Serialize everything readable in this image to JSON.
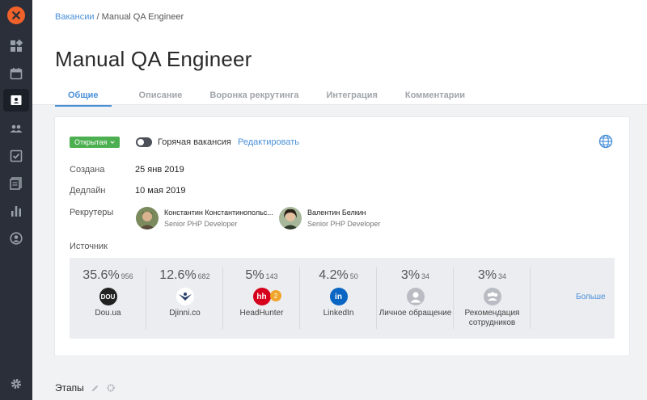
{
  "breadcrumb": {
    "parent": "Вакансии",
    "separator": " / ",
    "current": "Manual QA Engineer"
  },
  "page": {
    "title": "Manual QA Engineer"
  },
  "tabs": [
    {
      "label": "Общие",
      "active": true
    },
    {
      "label": "Описание"
    },
    {
      "label": "Воронка рекрутинга"
    },
    {
      "label": "Интеграция"
    },
    {
      "label": "Комментарии"
    }
  ],
  "vacancy": {
    "status": "Открытая",
    "hot_label": "Горячая вакансия",
    "edit_label": "Редактировать",
    "created_label": "Создана",
    "created_value": "25 янв 2019",
    "deadline_label": "Дедлайн",
    "deadline_value": "10 мая 2019",
    "recruiters_label": "Рекрутеры",
    "source_label": "Источник"
  },
  "recruiters": [
    {
      "name": "Константин Константинопольс...",
      "role": "Senior PHP Developer"
    },
    {
      "name": "Валентин Белкин",
      "role": "Senior PHP Developer"
    }
  ],
  "sources": [
    {
      "percent": "35.6%",
      "count": "956",
      "name": "Dou.ua",
      "icon": "dou-logo-icon",
      "color": "#222222"
    },
    {
      "percent": "12.6%",
      "count": "682",
      "name": "Djinni.co",
      "icon": "djinni-logo-icon",
      "color": "#ffffff"
    },
    {
      "percent": "5%",
      "count": "143",
      "name": "HeadHunter",
      "icon": "headhunter-logo-icon",
      "color": "#d6001c",
      "badge": "2"
    },
    {
      "percent": "4.2%",
      "count": "50",
      "name": "LinkedIn",
      "icon": "linkedin-logo-icon",
      "color": "#0a66c2"
    },
    {
      "percent": "3%",
      "count": "34",
      "name": "Личное обращение",
      "icon": "person-icon",
      "color": "#b9bdc3"
    },
    {
      "percent": "3%",
      "count": "34",
      "name": "Рекомендация сотрудников",
      "icon": "group-icon",
      "color": "#b9bdc3"
    }
  ],
  "more_label": "Больше",
  "stages": {
    "title": "Этапы"
  },
  "colors": {
    "accent": "#4a90d9",
    "status_open": "#4caf50",
    "sidebar": "#2a2f3a",
    "logo": "#f0622a"
  }
}
